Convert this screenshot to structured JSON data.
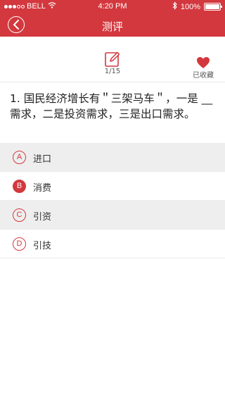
{
  "status": {
    "carrier": "BELL",
    "time": "4:20 PM",
    "battery": "100%"
  },
  "nav": {
    "title": "测评"
  },
  "toolbar": {
    "progress": "1/15",
    "favorite_label": "已收藏"
  },
  "question": {
    "text": "1. 国民经济增长有＂三架马车＂，一是 __ 需求，二是投资需求，三是出口需求。"
  },
  "options": [
    {
      "letter": "A",
      "text": "进口",
      "selected": false
    },
    {
      "letter": "B",
      "text": "消费",
      "selected": true
    },
    {
      "letter": "C",
      "text": "引资",
      "selected": false
    },
    {
      "letter": "D",
      "text": "引技",
      "selected": false
    }
  ],
  "colors": {
    "accent": "#d3383e",
    "option_shade": "#eeeeee"
  }
}
